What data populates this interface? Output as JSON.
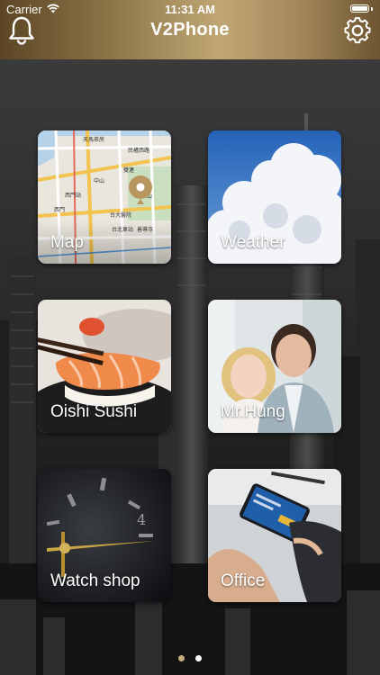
{
  "status_bar": {
    "carrier": "Carrier",
    "time": "11:31 AM"
  },
  "header": {
    "title": "V2Phone",
    "left_icon": "bell-icon",
    "right_icon": "gear-icon"
  },
  "tiles": [
    {
      "label": "Map"
    },
    {
      "label": "Weather"
    },
    {
      "label": "Oishi Sushi"
    },
    {
      "label": "Mr.Hung"
    },
    {
      "label": "Watch shop"
    },
    {
      "label": "Office"
    }
  ],
  "map_labels": [
    "天馬茶房",
    "民權西路",
    "雙連",
    "中山",
    "華山",
    "西門站",
    "台大醫院",
    "台北車站",
    "善導寺",
    "西門",
    "台北101"
  ],
  "pager": {
    "pages": 2,
    "current": 1,
    "active_color": "#c8ad7f",
    "inactive_color": "#ffffff"
  },
  "colors": {
    "header_gold": "#b09563"
  }
}
